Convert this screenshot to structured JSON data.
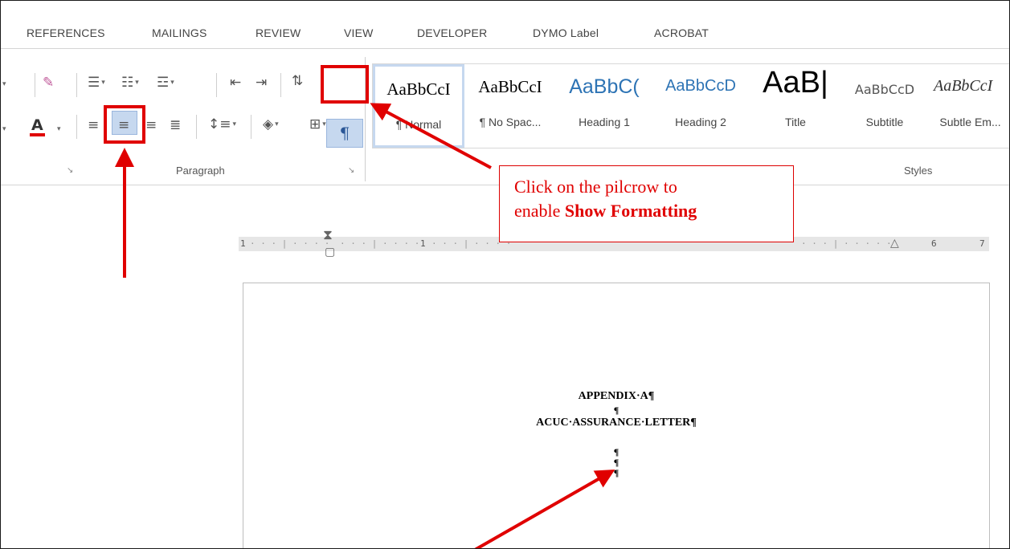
{
  "tabs": [
    "REFERENCES",
    "MAILINGS",
    "REVIEW",
    "VIEW",
    "DEVELOPER",
    "DYMO Label",
    "ACROBAT"
  ],
  "ribbon": {
    "paragraph_group_label": "Paragraph",
    "styles_group_label": "Styles",
    "pilcrow_symbol": "¶",
    "font_color_letter": "A",
    "launcher_glyph": "↘"
  },
  "styles": [
    {
      "sample": "AaBbCcI",
      "name": "¶ Normal",
      "selected": true
    },
    {
      "sample": "AaBbCcI",
      "name": "¶ No Spac...",
      "selected": false
    },
    {
      "sample": "AaBbC(",
      "name": "Heading 1",
      "selected": false
    },
    {
      "sample": "AaBbCcD",
      "name": "Heading 2",
      "selected": false
    },
    {
      "sample": "AaB|",
      "name": "Title",
      "selected": false
    },
    {
      "sample": "AaBbCcD",
      "name": "Subtitle",
      "selected": false
    },
    {
      "sample": "AaBbCcI",
      "name": "Subtle Em...",
      "selected": false
    }
  ],
  "ruler": {
    "marks": [
      "1",
      "1",
      "6",
      "7"
    ]
  },
  "document": {
    "lines": [
      "APPENDIX·A¶",
      "¶",
      "ACUC·ASSURANCE·LETTER¶",
      "¶",
      "¶",
      "¶"
    ]
  },
  "callout": {
    "line1": "Click on the pilcrow to",
    "line2_prefix": "enable ",
    "line2_bold": "Show Formatting"
  },
  "colors": {
    "annotation_red": "#e00000",
    "selection_blue": "#c6d8ef",
    "style_heading_blue": "#2e74b5"
  },
  "icons": [
    "eraser-icon",
    "bullets-icon",
    "numbering-icon",
    "multilevel-list-icon",
    "decrease-indent-icon",
    "increase-indent-icon",
    "sort-icon",
    "pilcrow-icon",
    "align-left-icon",
    "align-center-icon",
    "align-right-icon",
    "justify-icon",
    "line-spacing-icon",
    "shading-icon",
    "borders-icon",
    "font-color-icon"
  ]
}
